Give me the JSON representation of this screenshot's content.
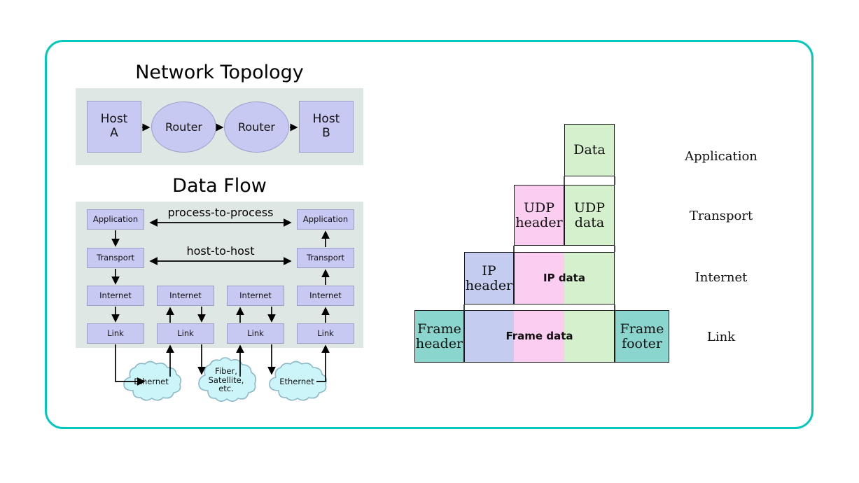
{
  "theme": {
    "frame_border": "#00c8bc",
    "panel_bg": "#dfe7e5",
    "node_fill": "#c7c9f2",
    "node_stroke": "#9b9ec9",
    "cloud_fill": "#ccf5fa",
    "cloud_stroke": "#8fb8c6",
    "enc_green": "#d5f0cd",
    "enc_pink": "#fbcdf0",
    "enc_blue": "#c4cdf0",
    "enc_teal": "#8ad5cd",
    "enc_stroke": "#1a1a1a"
  },
  "topology": {
    "title": "Network Topology",
    "nodes": [
      {
        "id": "host-a",
        "label": "Host\nA",
        "shape": "rect"
      },
      {
        "id": "router-1",
        "label": "Router",
        "shape": "circle"
      },
      {
        "id": "router-2",
        "label": "Router",
        "shape": "circle"
      },
      {
        "id": "host-b",
        "label": "Host\nB",
        "shape": "rect"
      }
    ],
    "host_a_line1": "Host",
    "host_a_line2": "A",
    "host_b_line1": "Host",
    "host_b_line2": "B",
    "router_1_label": "Router",
    "router_2_label": "Router"
  },
  "dataflow": {
    "title": "Data Flow",
    "layer_names": [
      "Application",
      "Transport",
      "Internet",
      "Link"
    ],
    "columns": [
      {
        "id": "host-a-stack",
        "layers": [
          "Application",
          "Transport",
          "Internet",
          "Link"
        ]
      },
      {
        "id": "router-1-stack",
        "layers": [
          "Internet",
          "Link"
        ]
      },
      {
        "id": "router-2-stack",
        "layers": [
          "Internet",
          "Link"
        ]
      },
      {
        "id": "host-b-stack",
        "layers": [
          "Application",
          "Transport",
          "Internet",
          "Link"
        ]
      }
    ],
    "boxes": {
      "app_left": "Application",
      "app_right": "Application",
      "transport_left": "Transport",
      "transport_right": "Transport",
      "internet_1": "Internet",
      "internet_2": "Internet",
      "internet_3": "Internet",
      "internet_4": "Internet",
      "link_1": "Link",
      "link_2": "Link",
      "link_3": "Link",
      "link_4": "Link"
    },
    "flow_labels": {
      "process": "process-to-process",
      "host": "host-to-host"
    },
    "clouds": [
      {
        "id": "cloud-ethernet-left",
        "label": "Ethernet"
      },
      {
        "id": "cloud-fiber",
        "label": "Fiber,\nSatellite,\netc."
      },
      {
        "id": "cloud-ethernet-right",
        "label": "Ethernet"
      }
    ],
    "cloud_left_label": "Ethernet",
    "cloud_mid_line1": "Fiber,",
    "cloud_mid_line2": "Satellite,",
    "cloud_mid_line3": "etc.",
    "cloud_right_label": "Ethernet"
  },
  "encapsulation": {
    "layers": [
      {
        "id": "application",
        "layer_label": "Application",
        "cells": [
          {
            "id": "data",
            "label": "Data",
            "color": "green",
            "font": "serif"
          }
        ]
      },
      {
        "id": "transport",
        "layer_label": "Transport",
        "cells": [
          {
            "id": "udp-header",
            "label": "UDP\nheader",
            "color": "pink",
            "font": "serif"
          },
          {
            "id": "udp-data",
            "label": "UDP\ndata",
            "color": "green",
            "font": "serif"
          }
        ]
      },
      {
        "id": "internet",
        "layer_label": "Internet",
        "cells": [
          {
            "id": "ip-header",
            "label": "IP\nheader",
            "color": "blue",
            "font": "serif"
          },
          {
            "id": "ip-data-pink",
            "label": "IP data",
            "color": "pink",
            "font": "sans"
          },
          {
            "id": "ip-data-green",
            "label": "",
            "color": "green",
            "font": "sans"
          }
        ]
      },
      {
        "id": "link",
        "layer_label": "Link",
        "cells": [
          {
            "id": "frame-header",
            "label": "Frame\nheader",
            "color": "teal",
            "font": "serif"
          },
          {
            "id": "frame-data-blue",
            "label": "",
            "color": "blue",
            "font": "sans"
          },
          {
            "id": "frame-data-pink",
            "label": "Frame data",
            "color": "pink",
            "font": "sans"
          },
          {
            "id": "frame-data-green",
            "label": "",
            "color": "green",
            "font": "sans"
          },
          {
            "id": "frame-footer",
            "label": "Frame\nfooter",
            "color": "teal",
            "font": "serif"
          }
        ]
      }
    ],
    "text": {
      "data": "Data",
      "udp_header_l1": "UDP",
      "udp_header_l2": "header",
      "udp_data_l1": "UDP",
      "udp_data_l2": "data",
      "ip_header_l1": "IP",
      "ip_header_l2": "header",
      "ip_data": "IP data",
      "frame_header_l1": "Frame",
      "frame_header_l2": "header",
      "frame_data": "Frame data",
      "frame_footer_l1": "Frame",
      "frame_footer_l2": "footer"
    },
    "layer_labels": {
      "application": "Application",
      "transport": "Transport",
      "internet": "Internet",
      "link": "Link"
    }
  }
}
